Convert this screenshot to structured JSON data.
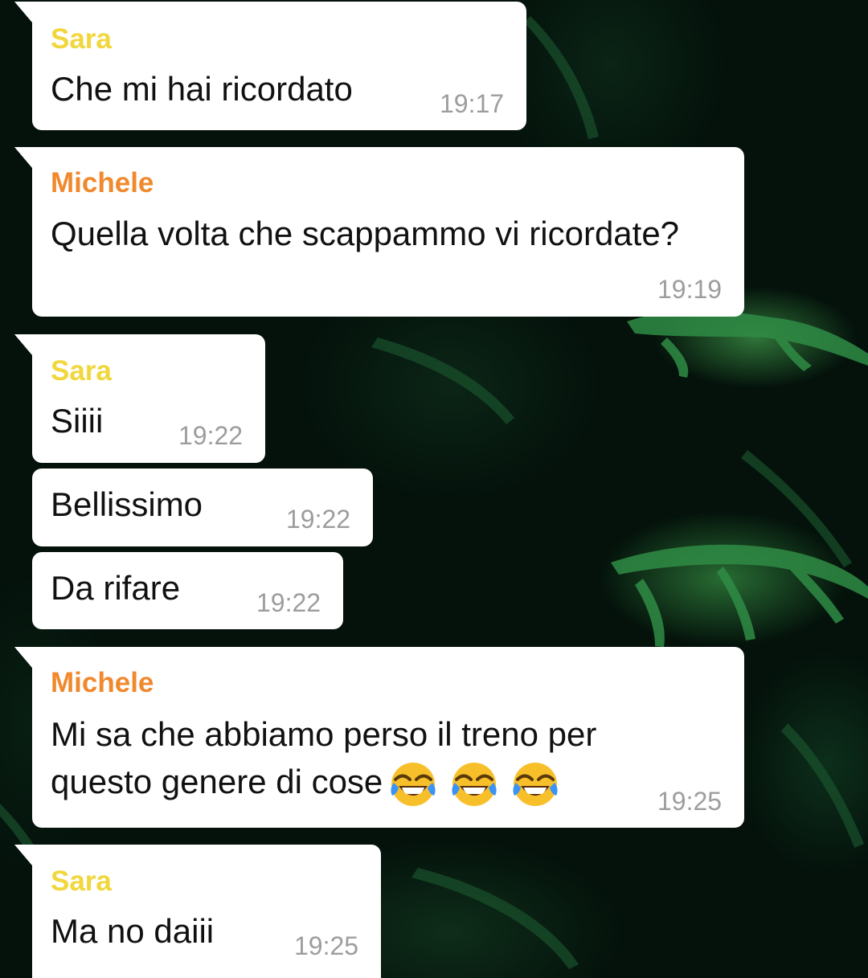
{
  "chat": {
    "messages": [
      {
        "sender": "Sara",
        "text": "Che mi hai ricordato",
        "time": "19:17"
      },
      {
        "sender": "Michele",
        "text": "Quella volta che scappammo vi ricordate?",
        "time": "19:19"
      },
      {
        "sender": "Sara",
        "text": "Siiii",
        "time": "19:22"
      },
      {
        "sender": "",
        "text": "Bellissimo",
        "time": "19:22"
      },
      {
        "sender": "",
        "text": "Da rifare",
        "time": "19:22"
      },
      {
        "sender": "Michele",
        "text_line1": "Mi sa che abbiamo perso il treno per",
        "text_line2": "questo genere di cose",
        "emoji": "face-with-tears-of-joy-icon x3",
        "time": "19:25"
      },
      {
        "sender": "Sara",
        "text": "Ma no daiii",
        "time": "19:25"
      }
    ]
  },
  "colors": {
    "sara_name": "#f1d73c",
    "michele_name": "#f0892e",
    "bubble": "#ffffff",
    "timestamp": "#9d9d9d",
    "background": "#04120b"
  }
}
